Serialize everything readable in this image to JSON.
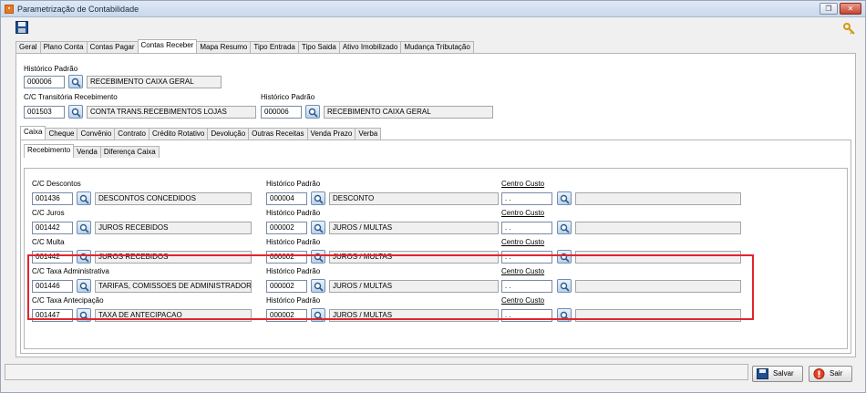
{
  "window": {
    "title": "Parametrização de Contabilidade"
  },
  "main_tabs": [
    "Geral",
    "Plano Conta",
    "Contas Pagar",
    "Contas Receber",
    "Mapa Resumo",
    "Tipo Entrada",
    "Tipo Saida",
    "Ativo Imobilizado",
    "Mudança Tributação"
  ],
  "receber": {
    "historico_padrao": {
      "label": "Histórico Padrão",
      "code": "000006",
      "desc": "RECEBIMENTO CAIXA GERAL"
    },
    "cc_transitoria": {
      "label": "C/C Transitória Recebimento",
      "code": "001503",
      "desc": "CONTA TRANS.RECEBIMENTOS LOJAS"
    },
    "historico_padrao2": {
      "label": "Histórico Padrão",
      "code": "000006",
      "desc": "RECEBIMENTO CAIXA GERAL"
    }
  },
  "sub_tabs": [
    "Caixa",
    "Cheque",
    "Convênio",
    "Contrato",
    "Crédito Rotativo",
    "Devolução",
    "Outras Receitas",
    "Venda Prazo",
    "Verba"
  ],
  "inner_tabs": [
    "Recebimento",
    "Venda",
    "Diferença Caixa"
  ],
  "rows": [
    {
      "cc_label": "C/C Descontos",
      "cc_code": "001436",
      "cc_desc": "DESCONTOS CONCEDIDOS",
      "hist_label": "Histórico Padrão",
      "hist_code": "000004",
      "hist_desc": "DESCONTO",
      "centro_label": "Centro Custo",
      "centro_value": ". ."
    },
    {
      "cc_label": "C/C Juros",
      "cc_code": "001442",
      "cc_desc": "JUROS RECEBIDOS",
      "hist_label": "Histórico Padrão",
      "hist_code": "000002",
      "hist_desc": "JUROS / MULTAS",
      "centro_label": "Centro Custo",
      "centro_value": ". ."
    },
    {
      "cc_label": "C/C Multa",
      "cc_code": "001442",
      "cc_desc": "JUROS RECEBIDOS",
      "hist_label": "Histórico Padrão",
      "hist_code": "000002",
      "hist_desc": "JUROS / MULTAS",
      "centro_label": "Centro Custo",
      "centro_value": ". ."
    },
    {
      "cc_label": "C/C Taxa Administrativa",
      "cc_code": "001446",
      "cc_desc": "TARIFAS, COMISSOES DE ADMINISTRADORAS DE",
      "hist_label": "Histórico Padrão",
      "hist_code": "000002",
      "hist_desc": "JUROS / MULTAS",
      "centro_label": "Centro Custo",
      "centro_value": ". ."
    },
    {
      "cc_label": "C/C Taxa Antecipação",
      "cc_code": "001447",
      "cc_desc": "TAXA DE ANTECIPACAO",
      "hist_label": "Histórico Padrão",
      "hist_code": "000002",
      "hist_desc": "JUROS / MULTAS",
      "centro_label": "Centro Custo",
      "centro_value": ". ."
    }
  ],
  "buttons": {
    "salvar": "Salvar",
    "sair": "Sair"
  },
  "colors": {
    "highlight": "#e0262e",
    "title_bar": "#c9d8ec"
  },
  "icons": {
    "app": "app-icon",
    "save": "floppy-disk-icon",
    "key": "key-icon",
    "search": "search-lookup-icon",
    "exit": "exit-icon"
  }
}
